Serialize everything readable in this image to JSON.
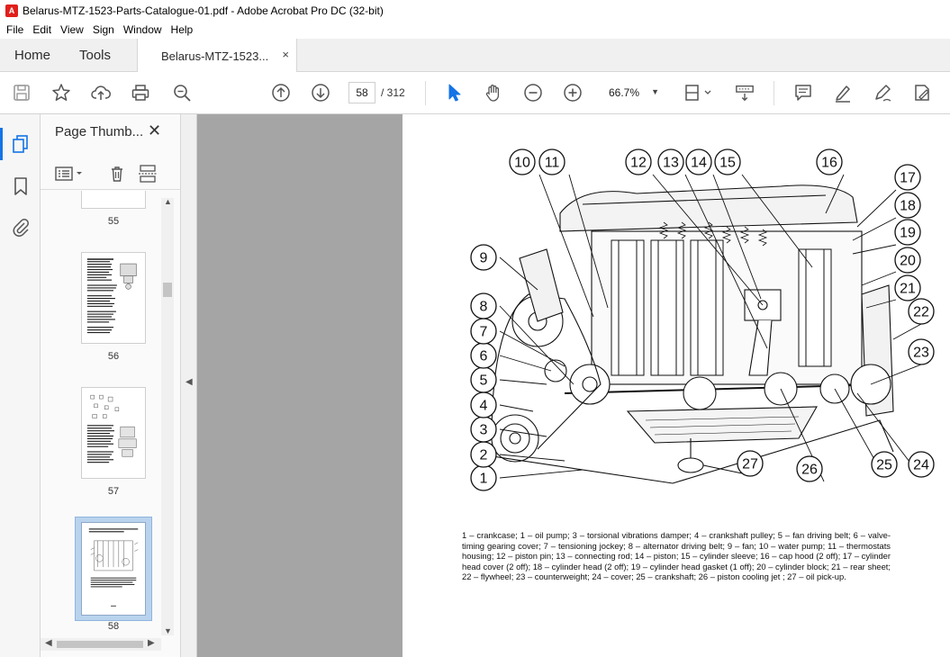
{
  "window": {
    "title": "Belarus-MTZ-1523-Parts-Catalogue-01.pdf - Adobe Acrobat Pro DC (32-bit)"
  },
  "menu": [
    "File",
    "Edit",
    "View",
    "Sign",
    "Window",
    "Help"
  ],
  "tabs": {
    "home": "Home",
    "tools": "Tools",
    "document": "Belarus-MTZ-1523...",
    "close": "×"
  },
  "toolbar": {
    "page_current": "58",
    "page_total": "/ 312",
    "zoom": "66.7%"
  },
  "thumb_panel": {
    "title": "Page Thumb...",
    "close": "✕",
    "pages": [
      {
        "label": "55"
      },
      {
        "label": "56"
      },
      {
        "label": "57"
      },
      {
        "label": "58",
        "selected": true
      }
    ]
  },
  "document": {
    "callouts": [
      "1",
      "2",
      "3",
      "4",
      "5",
      "6",
      "7",
      "8",
      "9",
      "10",
      "11",
      "12",
      "13",
      "14",
      "15",
      "16",
      "17",
      "18",
      "19",
      "20",
      "21",
      "22",
      "23",
      "24",
      "25",
      "26",
      "27"
    ],
    "caption": "1 – crankcase; 1 – oil pump; 3 – torsional vibrations damper; 4 – crankshaft pulley; 5 – fan driving belt; 6 – valve-timing gearing cover; 7 – tensioning jockey; 8 – alternator driving belt; 9 – fan; 10 – water pump; 11 – thermostats housing; 12 – piston pin; 13 – connecting rod; 14 – piston; 15 – cylinder sleeve; 16 – cap hood (2 off); 17 – cylinder head cover (2 off); 18 – cylinder head (2 off); 19 – cylinder head gasket (1 off); 20 – cylinder block; 21 – rear sheet; 22 – flywheel; 23 – counterweight; 24 – cover; 25 – crankshaft; 26 – piston cooling jet ; 27 – oil pick-up."
  }
}
